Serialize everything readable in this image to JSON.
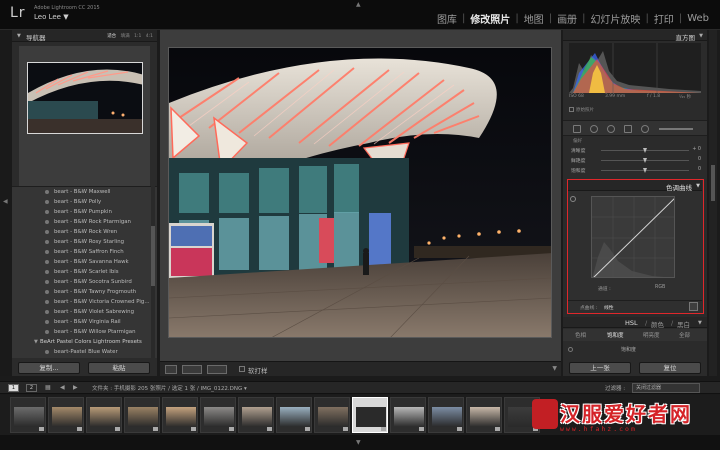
{
  "app": {
    "logo": "Lr",
    "product": "Adobe Lightroom CC 2015",
    "user": "Leo Lee",
    "user_caret": "▼"
  },
  "modules": [
    {
      "label": "图库",
      "active": false
    },
    {
      "label": "修改照片",
      "active": true
    },
    {
      "label": "地图",
      "active": false
    },
    {
      "label": "画册",
      "active": false
    },
    {
      "label": "幻灯片放映",
      "active": false
    },
    {
      "label": "打印",
      "active": false
    },
    {
      "label": "Web",
      "active": false
    }
  ],
  "navigator": {
    "title": "导航器",
    "zoom_options": [
      "适合",
      "填满",
      "1:1",
      "4:1"
    ],
    "zoom_active": "适合"
  },
  "presets": [
    {
      "label": "beart - B&W Maxwell",
      "type": "item"
    },
    {
      "label": "beart - B&W Polly",
      "type": "item"
    },
    {
      "label": "beart - B&W Pumpkin",
      "type": "item"
    },
    {
      "label": "beart - B&W Rock Ptarmigan",
      "type": "item"
    },
    {
      "label": "beart - B&W Rock Wren",
      "type": "item"
    },
    {
      "label": "beart - B&W Rosy Starling",
      "type": "item"
    },
    {
      "label": "beart - B&W Saffron Finch",
      "type": "item"
    },
    {
      "label": "beart - B&W Savanna Hawk",
      "type": "item"
    },
    {
      "label": "beart - B&W Scarlet Ibis",
      "type": "item"
    },
    {
      "label": "beart - B&W Socotra Sunbird",
      "type": "item"
    },
    {
      "label": "beart - B&W Tawny Frogmouth",
      "type": "item"
    },
    {
      "label": "beart - B&W Victoria Crowned Pig...",
      "type": "item"
    },
    {
      "label": "beart - B&W Violet Sabrewing",
      "type": "item"
    },
    {
      "label": "beart - B&W Virginia Rail",
      "type": "item"
    },
    {
      "label": "beart - B&W Willow Ptarmigan",
      "type": "item"
    },
    {
      "label": "BeArt Pastel Colors Lightroom Presets",
      "type": "folder"
    },
    {
      "label": "beart-Pastel Blue Water",
      "type": "item"
    }
  ],
  "left_buttons": {
    "copy": "复制...",
    "paste": "粘贴"
  },
  "toolbar": {
    "soft_proof": "软打样"
  },
  "histogram": {
    "title": "直方图",
    "iso": "ISO 68",
    "focal": "3.99 mm",
    "aperture": "f / 1.8",
    "shutter": "¹⁄₂₅ 秒",
    "original_photo": "原始照片"
  },
  "basic_sliders": {
    "section": "偏好",
    "rows": [
      {
        "label": "清晰度",
        "value": "+ 0",
        "pos": 0.5
      },
      {
        "label": "鲜艳度",
        "value": "0",
        "pos": 0.5
      },
      {
        "label": "饱和度",
        "value": "0",
        "pos": 0.5
      }
    ]
  },
  "tone_curve": {
    "title": "色调曲线",
    "region_label": "通道 :",
    "channel": "RGB",
    "point_curve_label": "点曲线 :",
    "point_curve_value": "线性"
  },
  "hsl": {
    "tabs_header": [
      "HSL",
      "颜色",
      "黑白"
    ],
    "tabs": [
      {
        "label": "色相",
        "active": false
      },
      {
        "label": "饱和度",
        "active": true
      },
      {
        "label": "明亮度",
        "active": false
      },
      {
        "label": "全部",
        "active": false
      }
    ],
    "sub_label": "饱和度"
  },
  "right_buttons": {
    "previous": "上一张",
    "reset": "复位"
  },
  "filmstrip_bar": {
    "page1": "1",
    "page2": "2",
    "info": "文件夹 : 手机摄影   205 张照片 / 选定 1 张 / IMG_0122.DNG ▾",
    "filter_label": "过滤器 :",
    "filter_value": "关闭过滤器"
  },
  "watermark": {
    "seal": "汉",
    "name": "汉服爱好者网",
    "url": "www.hfahz.com"
  },
  "colors": {
    "accent_red": "#e0272b",
    "panel_bg": "#2b2b2b",
    "topbar_bg": "#0c0c0c"
  }
}
